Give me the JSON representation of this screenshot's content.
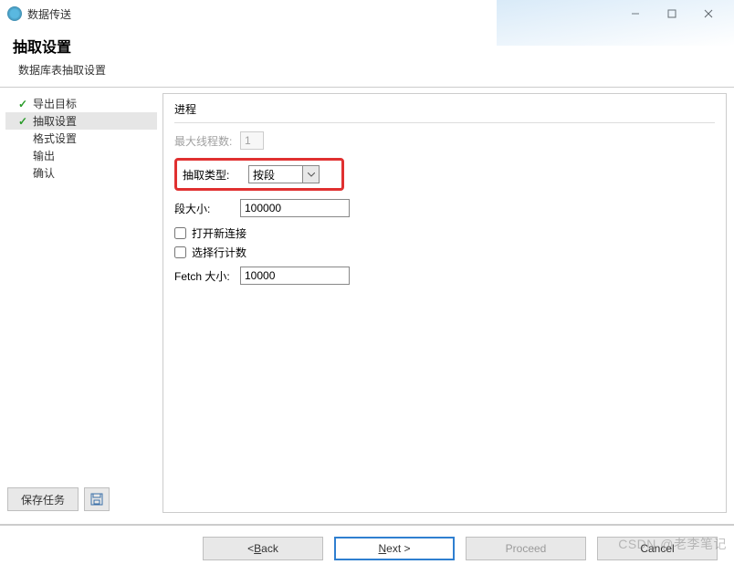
{
  "window": {
    "title": "数据传送"
  },
  "heading": {
    "title": "抽取设置",
    "subtitle": "数据库表抽取设置"
  },
  "sidebar": {
    "steps": [
      {
        "label": "导出目标",
        "done": true,
        "active": false
      },
      {
        "label": "抽取设置",
        "done": true,
        "active": true
      },
      {
        "label": "格式设置",
        "done": false,
        "active": false
      },
      {
        "label": "输出",
        "done": false,
        "active": false
      },
      {
        "label": "确认",
        "done": false,
        "active": false
      }
    ],
    "save_task_label": "保存任务"
  },
  "form": {
    "section_label": "进程",
    "max_threads_label": "最大线程数:",
    "max_threads_value": "1",
    "extract_type_label": "抽取类型:",
    "extract_type_value": "按段",
    "segment_size_label": "段大小:",
    "segment_size_value": "100000",
    "open_new_conn_label": "打开新连接",
    "open_new_conn_checked": false,
    "select_row_count_label": "选择行计数",
    "select_row_count_checked": false,
    "fetch_size_label": "Fetch 大小:",
    "fetch_size_value": "10000"
  },
  "footer": {
    "back_label_prefix": "< ",
    "back_mnemonic": "B",
    "back_label_suffix": "ack",
    "next_mnemonic": "N",
    "next_label_suffix": "ext >",
    "proceed_label": "Proceed",
    "cancel_label": "Cancel"
  },
  "watermark": "CSDN @老李笔记"
}
